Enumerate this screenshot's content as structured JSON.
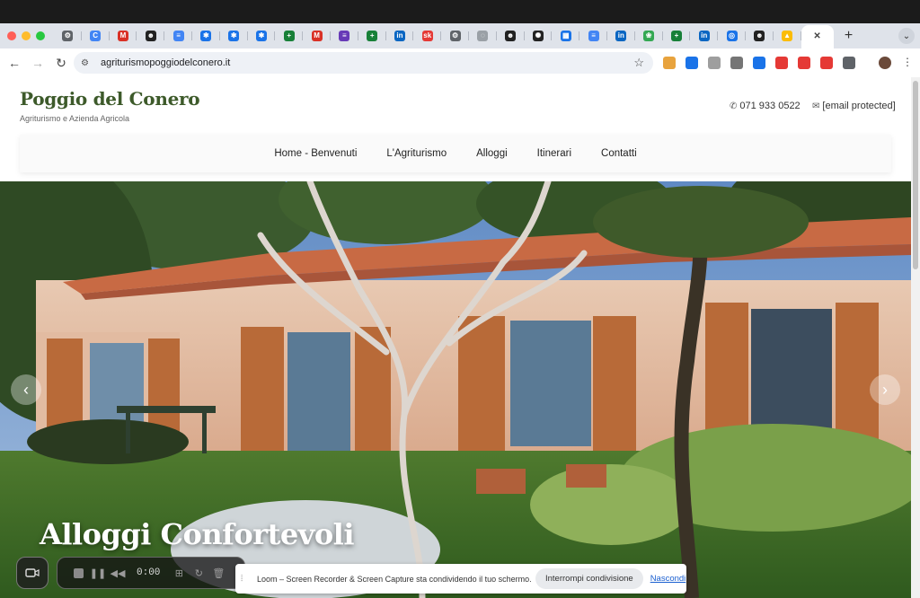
{
  "browser": {
    "tabs": [
      {
        "icon": "settings-icon",
        "color": "#5f6368",
        "glyph": "⚙",
        "active": false
      },
      {
        "icon": "chrome-icon",
        "color": "#4285f4",
        "glyph": "C",
        "active": false
      },
      {
        "icon": "gmail-icon",
        "color": "#d93025",
        "glyph": "M",
        "active": false
      },
      {
        "icon": "emoji-icon",
        "color": "#222222",
        "glyph": "☻",
        "active": false
      },
      {
        "icon": "docs-icon",
        "color": "#4285f4",
        "glyph": "≡",
        "active": false
      },
      {
        "icon": "asterisk-icon",
        "color": "#1a73e8",
        "glyph": "✱",
        "active": false
      },
      {
        "icon": "asterisk-icon",
        "color": "#1a73e8",
        "glyph": "✱",
        "active": false
      },
      {
        "icon": "asterisk-icon",
        "color": "#1a73e8",
        "glyph": "✱",
        "active": false
      },
      {
        "icon": "sheets-icon",
        "color": "#188038",
        "glyph": "+",
        "active": false
      },
      {
        "icon": "gmail-icon",
        "color": "#d93025",
        "glyph": "M",
        "active": false
      },
      {
        "icon": "forms-icon",
        "color": "#673ab7",
        "glyph": "≡",
        "active": false
      },
      {
        "icon": "sheets-icon",
        "color": "#188038",
        "glyph": "+",
        "active": false
      },
      {
        "icon": "linkedin-icon",
        "color": "#0a66c2",
        "glyph": "in",
        "active": false
      },
      {
        "icon": "sk-icon",
        "color": "#e53935",
        "glyph": "sk",
        "active": false
      },
      {
        "icon": "settings-icon",
        "color": "#5f6368",
        "glyph": "⚙",
        "active": false
      },
      {
        "icon": "loading-icon",
        "color": "#9aa0a6",
        "glyph": "◌",
        "active": false
      },
      {
        "icon": "emoji-icon",
        "color": "#222222",
        "glyph": "☻",
        "active": false
      },
      {
        "icon": "openai-icon",
        "color": "#222222",
        "glyph": "✺",
        "active": false
      },
      {
        "icon": "calendar-icon",
        "color": "#1a73e8",
        "glyph": "▦",
        "active": false
      },
      {
        "icon": "docs-icon",
        "color": "#4285f4",
        "glyph": "≡",
        "active": false
      },
      {
        "icon": "linkedin-icon",
        "color": "#0a66c2",
        "glyph": "in",
        "active": false
      },
      {
        "icon": "leaf-icon",
        "color": "#34a853",
        "glyph": "❀",
        "active": false
      },
      {
        "icon": "sheets-icon",
        "color": "#188038",
        "glyph": "+",
        "active": false
      },
      {
        "icon": "linkedin-icon",
        "color": "#0a66c2",
        "glyph": "in",
        "active": false
      },
      {
        "icon": "extension-icon",
        "color": "#1a73e8",
        "glyph": "◎",
        "active": false
      },
      {
        "icon": "emoji-icon",
        "color": "#222222",
        "glyph": "☻",
        "active": false
      },
      {
        "icon": "drive-icon",
        "color": "#fbbc04",
        "glyph": "▲",
        "active": false
      },
      {
        "icon": "close-icon",
        "color": "#444444",
        "glyph": "✕",
        "active": true
      }
    ],
    "new_tab_glyph": "+",
    "url": "agriturismopoggiodelconero.it",
    "extensions": [
      "#e8a33d",
      "#1a73e8",
      "#9e9e9e",
      "#757575",
      "#1a73e8",
      "#e53935",
      "#e53935",
      "#e53935",
      "#5f6368"
    ]
  },
  "site": {
    "title": "Poggio del Conero",
    "tagline": "Agriturismo e Azienda Agricola",
    "phone": "071 933 0522",
    "email": "[email protected]",
    "nav": [
      "Home - Benvenuti",
      "L'Agriturismo",
      "Alloggi",
      "Itinerari",
      "Contatti"
    ]
  },
  "hero": {
    "slide_title": "Alloggi Confortevoli",
    "prev_glyph": "‹",
    "next_glyph": "›"
  },
  "loom": {
    "time": "0:00"
  },
  "share_banner": {
    "text": "Loom – Screen Recorder & Screen Capture sta condividendo il tuo schermo.",
    "stop_label": "Interrompi condivisione",
    "hide_label": "Nascondi"
  }
}
